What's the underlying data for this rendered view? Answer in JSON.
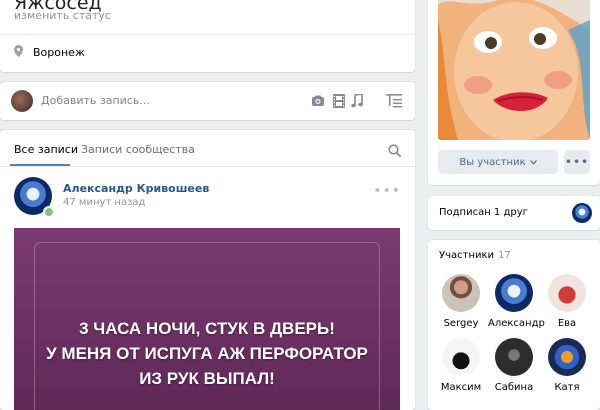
{
  "profile": {
    "name": "Яжсосед",
    "status_placeholder": "изменить статус",
    "city": "Воронеж"
  },
  "composer": {
    "placeholder": "Добавить запись...",
    "icons": [
      "camera-icon",
      "video-icon",
      "music-icon",
      "text-format-icon"
    ]
  },
  "wall": {
    "tabs": [
      {
        "label": "Все записи",
        "active": true
      },
      {
        "label": "Записи сообщества",
        "active": false
      }
    ],
    "post": {
      "author": "Александр Кривошеев",
      "time": "47 минут назад",
      "image_text": "3 ЧАСА НОЧИ, СТУК В ДВЕРЬ!\nУ МЕНЯ ОТ ИСПУГА АЖ ПЕРФОРАТОР\nИЗ РУК ВЫПАЛ!"
    }
  },
  "sidebar": {
    "member_button": "Вы участник",
    "friends_text": "Подписан 1 друг",
    "members": {
      "title": "Участники",
      "count": "17",
      "list": [
        {
          "name": "Sergey"
        },
        {
          "name": "Александр"
        },
        {
          "name": "Ева"
        },
        {
          "name": "Максим"
        },
        {
          "name": "Сабина"
        },
        {
          "name": "Катя"
        }
      ]
    }
  },
  "colors": {
    "background": "#edeef0",
    "link": "#2a5885",
    "accent": "#5181b8",
    "post_bg": "#6b2f63"
  }
}
